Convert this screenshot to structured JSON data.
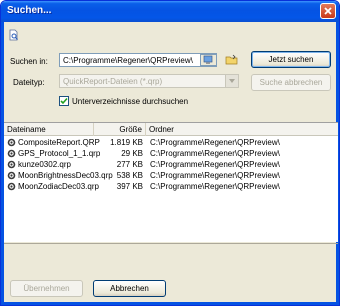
{
  "window": {
    "title": "Suchen..."
  },
  "icons": {
    "toolbar": "document-search-icon",
    "close": "close-icon",
    "browse": "browse-computer-icon",
    "folder": "folder-icon",
    "file": "qrp-file-icon"
  },
  "colors": {
    "titlebar": "#0553e3",
    "close": "#c8391b",
    "window": "#ece9d8"
  },
  "form": {
    "search_in_label": "Suchen in:",
    "search_in_value": "C:\\Programme\\Regener\\QRPreview\\",
    "filetype_label": "Dateityp:",
    "filetype_value": "QuickReport-Dateien (*.qrp)",
    "subdirs_label": "Unterverzeichnisse durchsuchen",
    "subdirs_checked": true
  },
  "buttons": {
    "search": "Jetzt suchen",
    "cancel_search": "Suche abbrechen",
    "apply": "Übernehmen",
    "cancel": "Abbrechen"
  },
  "table": {
    "columns": [
      "Dateiname",
      "Größe",
      "Ordner"
    ],
    "rows": [
      {
        "name": "CompositeReport.QRP",
        "size": "1.819 KB",
        "folder": "C:\\Programme\\Regener\\QRPreview\\"
      },
      {
        "name": "GPS_Protocol_1_1.qrp",
        "size": "29 KB",
        "folder": "C:\\Programme\\Regener\\QRPreview\\"
      },
      {
        "name": "kunze0302.qrp",
        "size": "277 KB",
        "folder": "C:\\Programme\\Regener\\QRPreview\\"
      },
      {
        "name": "MoonBrightnessDec03.qrp",
        "size": "538 KB",
        "folder": "C:\\Programme\\Regener\\QRPreview\\"
      },
      {
        "name": "MoonZodiacDec03.qrp",
        "size": "397 KB",
        "folder": "C:\\Programme\\Regener\\QRPreview\\"
      }
    ]
  }
}
